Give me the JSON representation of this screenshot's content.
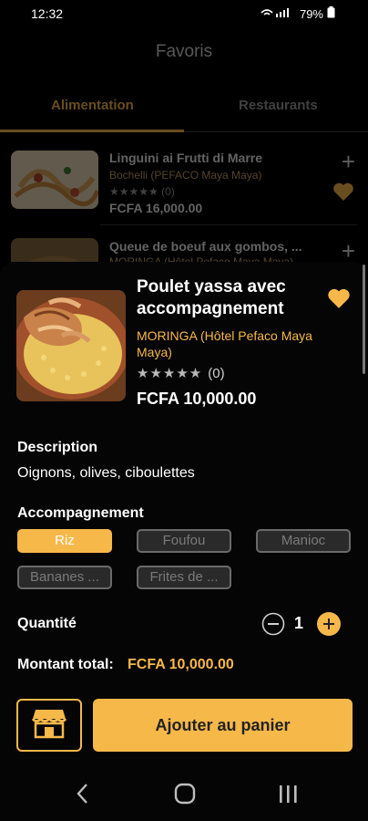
{
  "status": {
    "time": "12:32",
    "battery": "79%"
  },
  "header": {
    "title": "Favoris"
  },
  "tabs": [
    {
      "label": "Alimentation"
    },
    {
      "label": "Restaurants"
    }
  ],
  "favorites": [
    {
      "title": "Linguini ai Frutti di Marre",
      "restaurant": "Bochelli (PEFACO Maya Maya)",
      "rating": "★★★★★ (0)",
      "price": "FCFA 16,000.00"
    },
    {
      "title": "Queue de boeuf aux gombos, ...",
      "restaurant": "MORINGA (Hôtel Pefaco Maya Maya)"
    }
  ],
  "sheet": {
    "title": "Poulet yassa avec accompagnement",
    "restaurant": "MORINGA (Hôtel Pefaco Maya Maya)",
    "stars": "★★★★★",
    "rating_count": "(0)",
    "price": "FCFA 10,000.00",
    "description_title": "Description",
    "description": "Oignons, olives, ciboulettes",
    "accompaniment_title": "Accompagnement",
    "options": [
      {
        "label": "Riz"
      },
      {
        "label": "Foufou"
      },
      {
        "label": "Manioc"
      },
      {
        "label": "Bananes ..."
      },
      {
        "label": "Frites de ..."
      }
    ],
    "quantity_label": "Quantité",
    "quantity": "1",
    "total_label": "Montant total:",
    "total": "FCFA 10,000.00",
    "add_to_cart": "Ajouter au panier"
  },
  "colors": {
    "accent": "#f7b84a",
    "background": "#000000",
    "chip_inactive": "#2a2a2a"
  },
  "icons": [
    "signal-icon",
    "battery-icon",
    "plus-icon",
    "heart-icon",
    "store-icon",
    "minus-circle-icon",
    "plus-circle-icon",
    "nav-back-icon",
    "nav-home-icon",
    "nav-recents-icon"
  ]
}
